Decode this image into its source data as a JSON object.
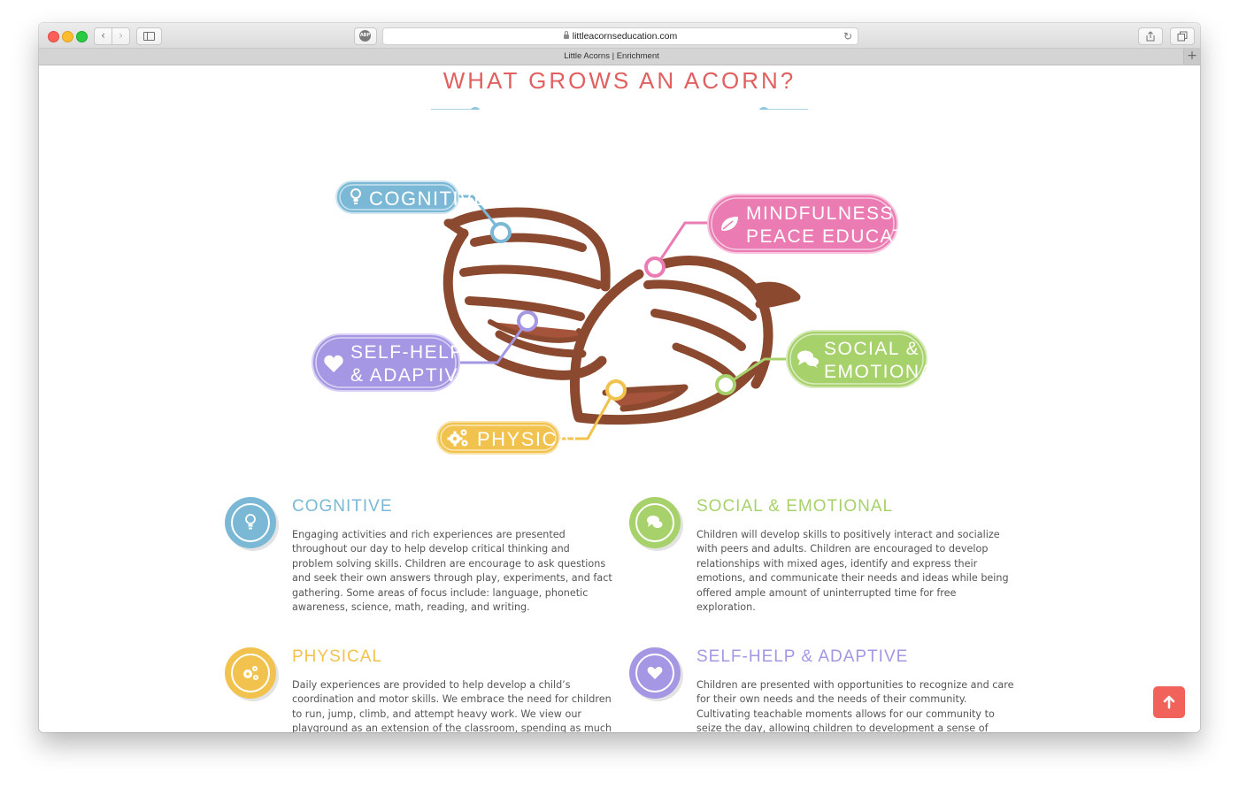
{
  "browser": {
    "url": "littleacornseducation.com",
    "tab_title": "Little Acorns | Enrichment",
    "abp_label": "ABP",
    "new_tab_label": "+"
  },
  "page": {
    "section_title": "WHAT GROWS AN ACORN?",
    "diagram_labels": {
      "cognitive": "COGNITIVE",
      "mindfulness_line1": "MINDFULNESS &",
      "mindfulness_line2": "PEACE EDUCATION",
      "selfhelp_line1": "SELF-HELP",
      "selfhelp_line2": "& ADAPTIVE",
      "social_line1": "SOCIAL &",
      "social_line2": "EMOTIONAL",
      "physical": "PHYSICAL"
    },
    "blocks": [
      {
        "title": "COGNITIVE",
        "color": "#7ab8d6",
        "icon": "lightbulb-icon",
        "text": "Engaging activities and rich experiences are presented throughout our day to help develop critical thinking and problem solving skills. Children are encourage to ask questions and seek their own answers through play, experiments, and fact gathering. Some areas of focus include: language, phonetic awareness, science, math, reading, and writing."
      },
      {
        "title": "SOCIAL & EMOTIONAL",
        "color": "#a7d16a",
        "icon": "chat-bubbles-icon",
        "text": "Children will develop skills to positively interact and socialize with peers and adults. Children are encouraged to develop relationships with mixed ages, identify and express their emotions, and communicate their needs and ideas while being offered ample amount of uninterrupted time for free exploration."
      },
      {
        "title": "PHYSICAL",
        "color": "#f1c24e",
        "icon": "gears-icon",
        "text": "Daily experiences are provided to help develop a child’s coordination and motor skills. We embrace the need for children to run, jump, climb, and attempt heavy work. We view our playground as an extension of the classroom, spending as much time learning outside as weather allows."
      },
      {
        "title": "SELF-HELP & ADAPTIVE",
        "color": "#a597e3",
        "icon": "heart-icon",
        "text": "Children are presented with opportunities to recognize and care for their own needs and the needs of their community. Cultivating teachable moments allows for our community to seize the day, allowing children to development a sense of flexibility and joy for learning."
      }
    ]
  },
  "colors": {
    "cognitive": "#7ab8d6",
    "mindfulness": "#ea7cb3",
    "selfhelp": "#a597e3",
    "social": "#a7d16a",
    "physical": "#f1c24e",
    "acorn": "#8b4a2f",
    "title": "#e06060",
    "scroll_top": "#f0625a"
  }
}
